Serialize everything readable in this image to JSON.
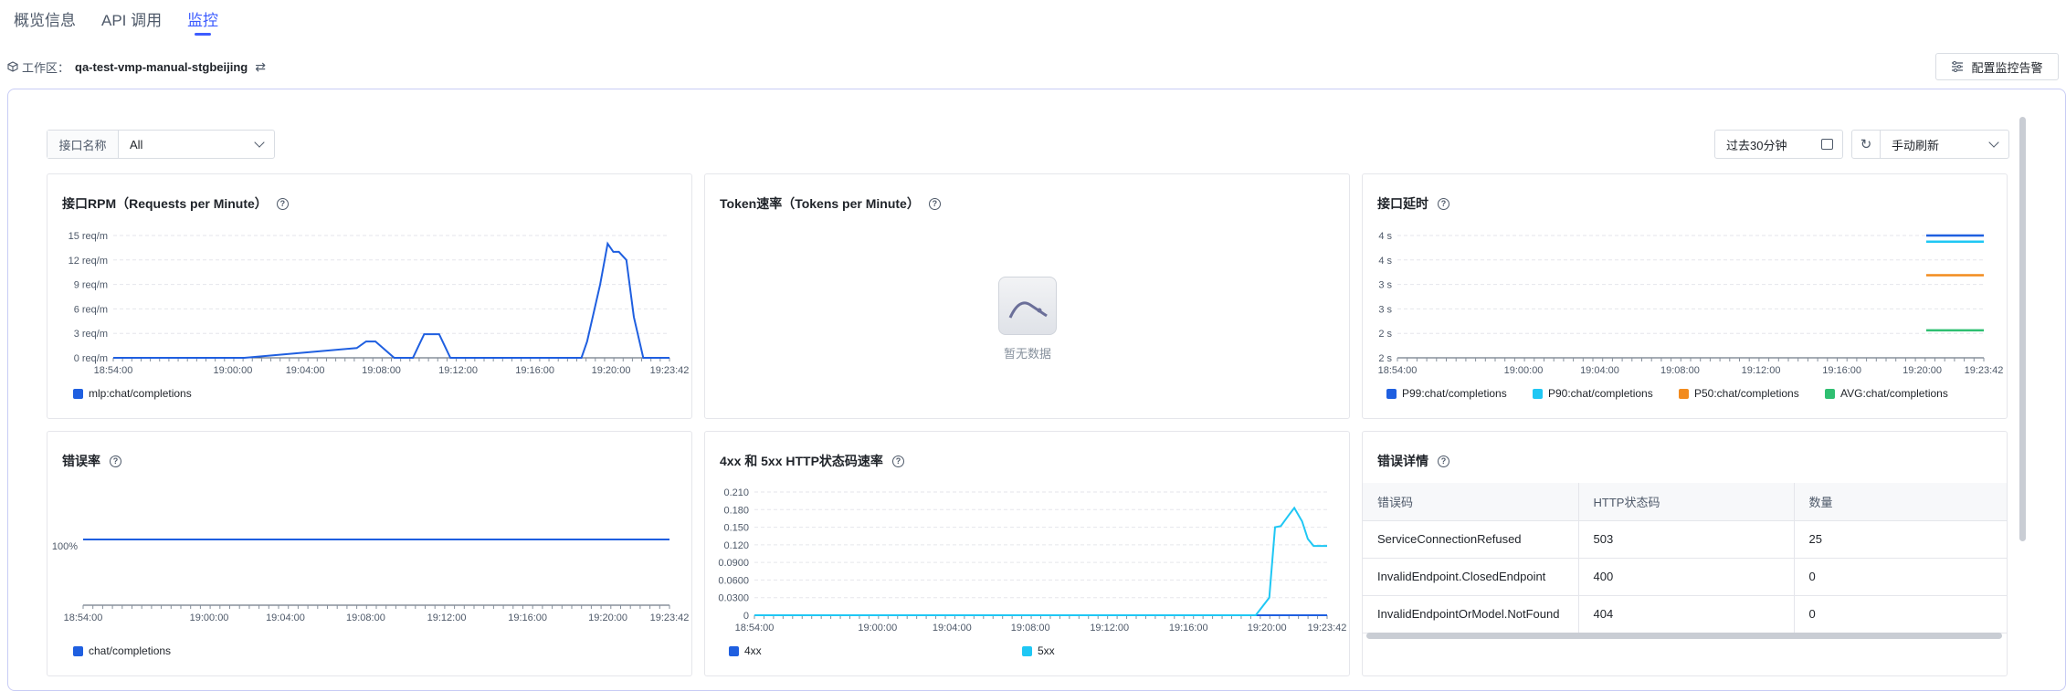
{
  "tabs": [
    {
      "label": "概览信息"
    },
    {
      "label": "API 调用"
    },
    {
      "label": "监控"
    }
  ],
  "workspace": {
    "label": "工作区：",
    "value": "qa-test-vmp-manual-stgbeijing"
  },
  "toolbar": {
    "alarm_label": "配置监控告警"
  },
  "filter": {
    "label": "接口名称",
    "value": "All"
  },
  "time_range": {
    "value": "过去30分钟"
  },
  "refresh": {
    "value": "手动刷新"
  },
  "colors": {
    "accent": "#3d5cff",
    "blue": "#1f5fe0",
    "cyan": "#1fc7f4",
    "orange": "#f28b1e",
    "green": "#2fbf71"
  },
  "charts": {
    "rpm": {
      "title": "接口RPM（Requests per Minute）",
      "legend": [
        "mlp:chat/completions"
      ]
    },
    "token": {
      "title": "Token速率（Tokens per Minute）",
      "empty_text": "暂无数据"
    },
    "latency": {
      "title": "接口延时",
      "legend": [
        "P99:chat/completions",
        "P90:chat/completions",
        "P50:chat/completions",
        "AVG:chat/completions"
      ]
    },
    "error_rate": {
      "title": "错误率",
      "legend": [
        "chat/completions"
      ]
    },
    "status": {
      "title": "4xx 和 5xx HTTP状态码速率",
      "legend": [
        "4xx",
        "5xx"
      ]
    }
  },
  "error_detail": {
    "title": "错误详情",
    "headers": [
      "错误码",
      "HTTP状态码",
      "数量"
    ],
    "rows": [
      [
        "ServiceConnectionRefused",
        "503",
        "25"
      ],
      [
        "InvalidEndpoint.ClosedEndpoint",
        "400",
        "0"
      ],
      [
        "InvalidEndpointOrModel.NotFound",
        "404",
        "0"
      ]
    ]
  },
  "chart_data": [
    {
      "type": "line",
      "title": "接口RPM（Requests per Minute）",
      "ylabels": [
        "0 req/m",
        "3 req/m",
        "6 req/m",
        "9 req/m",
        "12 req/m",
        "15 req/m"
      ],
      "ylim": [
        0,
        15
      ],
      "xlabels": [
        "18:54:00",
        "19:00:00",
        "19:04:00",
        "19:08:00",
        "19:12:00",
        "19:16:00",
        "19:20:00",
        "19:23:42"
      ],
      "series": [
        {
          "name": "mlp:chat/completions",
          "color": "#1f5fe0",
          "points": [
            [
              0,
              0
            ],
            [
              7.0,
              0
            ],
            [
              13.0,
              1.2
            ],
            [
              13.5,
              2
            ],
            [
              14.0,
              2
            ],
            [
              15.0,
              0
            ],
            [
              16.0,
              0
            ],
            [
              16.6,
              2.9
            ],
            [
              17.4,
              2.9
            ],
            [
              18.0,
              0
            ],
            [
              25.0,
              0
            ],
            [
              25.3,
              2
            ],
            [
              26.0,
              9
            ],
            [
              26.4,
              14
            ],
            [
              26.7,
              13
            ],
            [
              27.0,
              13
            ],
            [
              27.4,
              12
            ],
            [
              27.8,
              5
            ],
            [
              28.3,
              0
            ],
            [
              29.7,
              0
            ]
          ]
        }
      ],
      "grid": true,
      "legend_position": "bottom-left"
    },
    {
      "type": "line",
      "title": "接口延时",
      "ylabels": [
        "2 s",
        "2 s",
        "3 s",
        "3 s",
        "4 s",
        "4 s"
      ],
      "xlabels": [
        "18:54:00",
        "19:00:00",
        "19:04:00",
        "19:08:00",
        "19:12:00",
        "19:16:00",
        "19:20:00",
        "19:23:42"
      ],
      "series": [
        {
          "name": "P99:chat/completions",
          "color": "#1f5fe0",
          "value": 4.0
        },
        {
          "name": "P90:chat/completions",
          "color": "#1fc7f4",
          "value": 3.9
        },
        {
          "name": "P50:chat/completions",
          "color": "#f28b1e",
          "value": 3.35
        },
        {
          "name": "AVG:chat/completions",
          "color": "#2fbf71",
          "value": 2.45
        }
      ],
      "grid": true,
      "legend_position": "bottom-left"
    },
    {
      "type": "line",
      "title": "错误率",
      "ylabels": [
        "100%"
      ],
      "xlabels": [
        "18:54:00",
        "19:00:00",
        "19:04:00",
        "19:08:00",
        "19:12:00",
        "19:16:00",
        "19:20:00",
        "19:23:42"
      ],
      "series": [
        {
          "name": "chat/completions",
          "color": "#1f5fe0",
          "value": 100
        }
      ],
      "legend_position": "bottom-left"
    },
    {
      "type": "line",
      "title": "4xx 和 5xx HTTP状态码速率",
      "ylabels": [
        "0",
        "0.0300",
        "0.0600",
        "0.0900",
        "0.120",
        "0.150",
        "0.180",
        "0.210"
      ],
      "ylim": [
        0,
        0.21
      ],
      "xlabels": [
        "18:54:00",
        "19:00:00",
        "19:04:00",
        "19:08:00",
        "19:12:00",
        "19:16:00",
        "19:20:00",
        "19:23:42"
      ],
      "series": [
        {
          "name": "4xx",
          "color": "#1f5fe0",
          "points": [
            [
              0,
              0
            ],
            [
              29.7,
              0
            ]
          ]
        },
        {
          "name": "5xx",
          "color": "#1fc7f4",
          "points": [
            [
              0,
              0
            ],
            [
              26.0,
              0
            ],
            [
              26.7,
              0.03
            ],
            [
              27.0,
              0.15
            ],
            [
              27.3,
              0.152
            ],
            [
              27.7,
              0.17
            ],
            [
              28.0,
              0.183
            ],
            [
              28.4,
              0.16
            ],
            [
              28.7,
              0.13
            ],
            [
              29.0,
              0.118
            ],
            [
              29.7,
              0.118
            ]
          ]
        }
      ],
      "grid": true,
      "legend_position": "bottom"
    }
  ]
}
